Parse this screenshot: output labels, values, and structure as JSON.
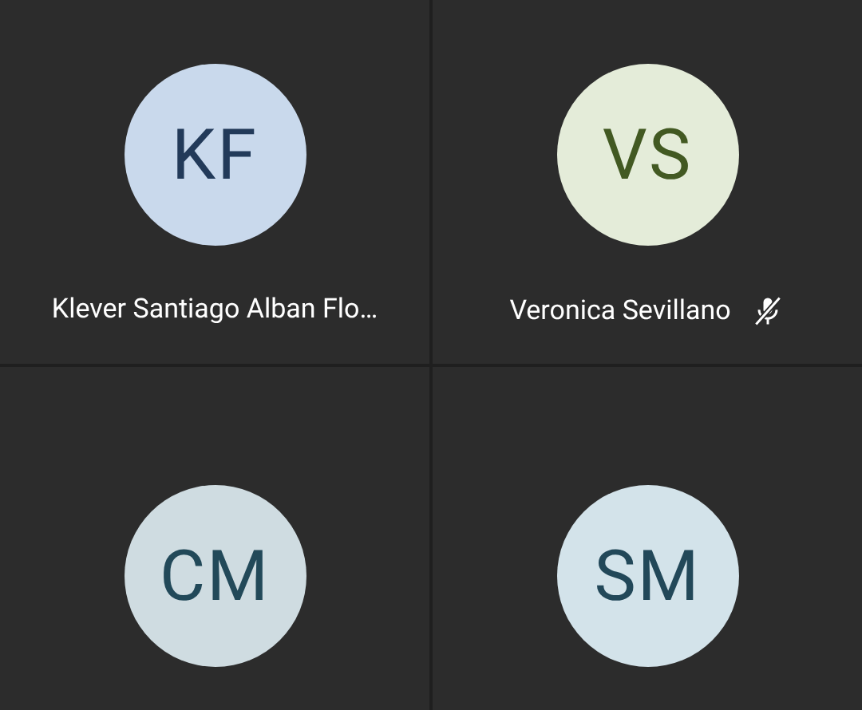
{
  "participants": [
    {
      "initials": "KF",
      "name": "Klever Santiago Alban Flo…",
      "muted": false,
      "color": "#c9d9ec"
    },
    {
      "initials": "VS",
      "name": "Veronica Sevillano",
      "muted": true,
      "color": "#e4ecd9"
    },
    {
      "initials": "CM",
      "color": "#cfdce1"
    },
    {
      "initials": "SM",
      "color": "#d3e3ea"
    }
  ]
}
